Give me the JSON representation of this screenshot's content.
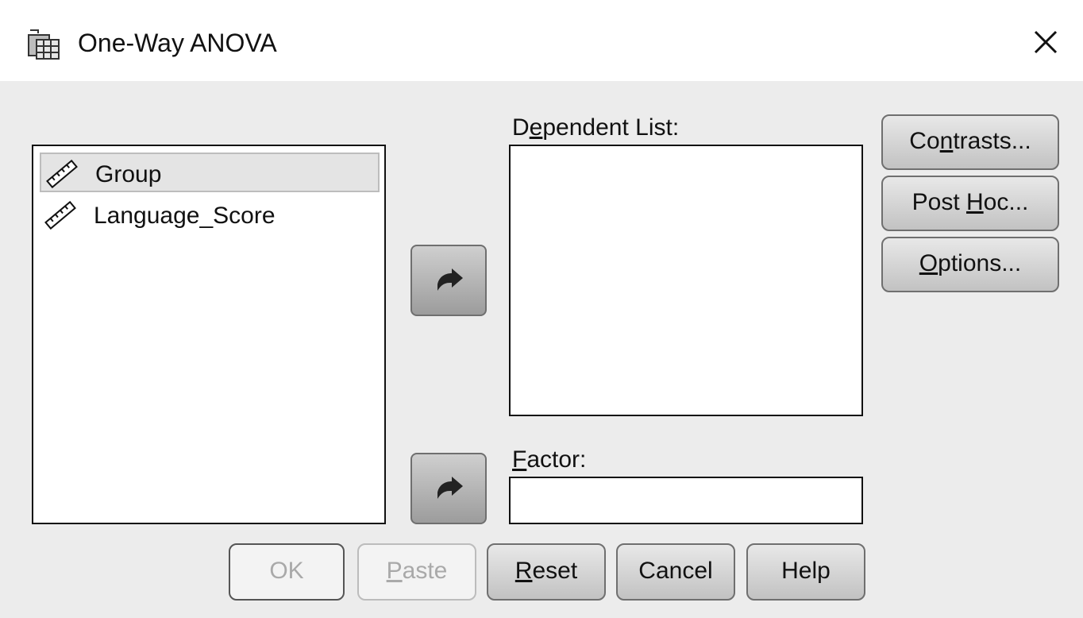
{
  "window": {
    "title": "One-Way ANOVA",
    "icon": "anova-table-icon",
    "close_icon": "close-icon"
  },
  "variables": [
    {
      "label": "Group",
      "icon": "scale-ruler-icon",
      "selected": true
    },
    {
      "label": "Language_Score",
      "icon": "scale-ruler-icon",
      "selected": false
    }
  ],
  "dependent": {
    "label_pre": "D",
    "label_mnemonic": "e",
    "label_post": "pendent List:",
    "items": []
  },
  "factor": {
    "label_mnemonic": "F",
    "label_post": "actor:",
    "value": ""
  },
  "side_buttons": {
    "contrasts": {
      "pre": "Co",
      "mnemonic": "n",
      "post": "trasts..."
    },
    "posthoc": {
      "pre": "Post ",
      "mnemonic": "H",
      "post": "oc..."
    },
    "options": {
      "pre": "",
      "mnemonic": "O",
      "post": "ptions..."
    }
  },
  "bottom_buttons": {
    "ok": {
      "label": "OK",
      "enabled": false
    },
    "paste": {
      "mnemonic": "P",
      "post": "aste",
      "enabled": false
    },
    "reset": {
      "mnemonic": "R",
      "post": "eset",
      "enabled": true
    },
    "cancel": {
      "label": "Cancel",
      "enabled": true
    },
    "help": {
      "label": "Help",
      "enabled": true
    }
  },
  "colors": {
    "dialog_bg": "#ececec",
    "button_border": "#6f6f6f",
    "disabled_text": "#a9a9a9"
  }
}
